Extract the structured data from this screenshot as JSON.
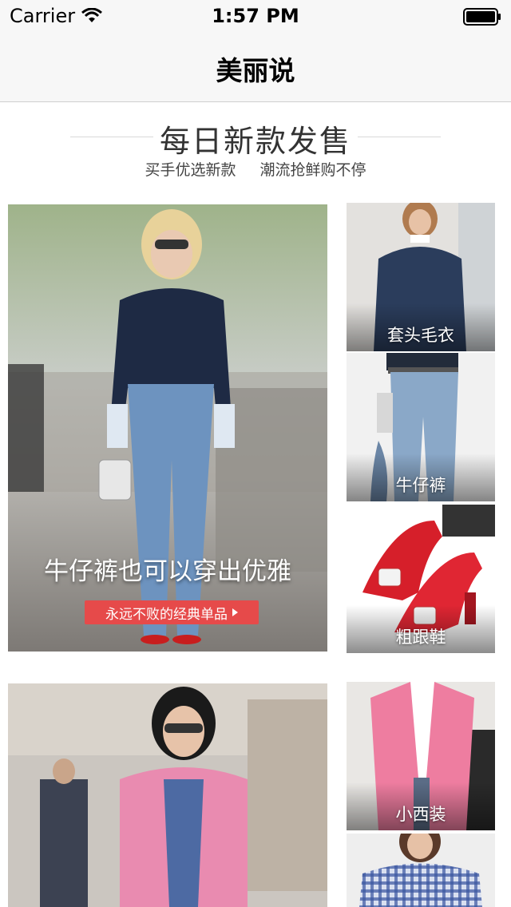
{
  "status_bar": {
    "carrier": "Carrier",
    "time": "1:57 PM"
  },
  "nav": {
    "title": "美丽说"
  },
  "section": {
    "title": "每日新款发售",
    "subtitle_left": "买手优选新款",
    "subtitle_right": "潮流抢鲜购不停"
  },
  "feature1": {
    "caption": "牛仔裤也可以穿出优雅",
    "button_label": "永远不败的经典单品",
    "tiles": [
      {
        "label": "套头毛衣"
      },
      {
        "label": "牛仔裤"
      },
      {
        "label": "粗跟鞋"
      }
    ]
  },
  "feature2": {
    "tiles": [
      {
        "label": "小西装"
      }
    ]
  },
  "colors": {
    "accent": "#e64a4a",
    "text": "#333333"
  }
}
